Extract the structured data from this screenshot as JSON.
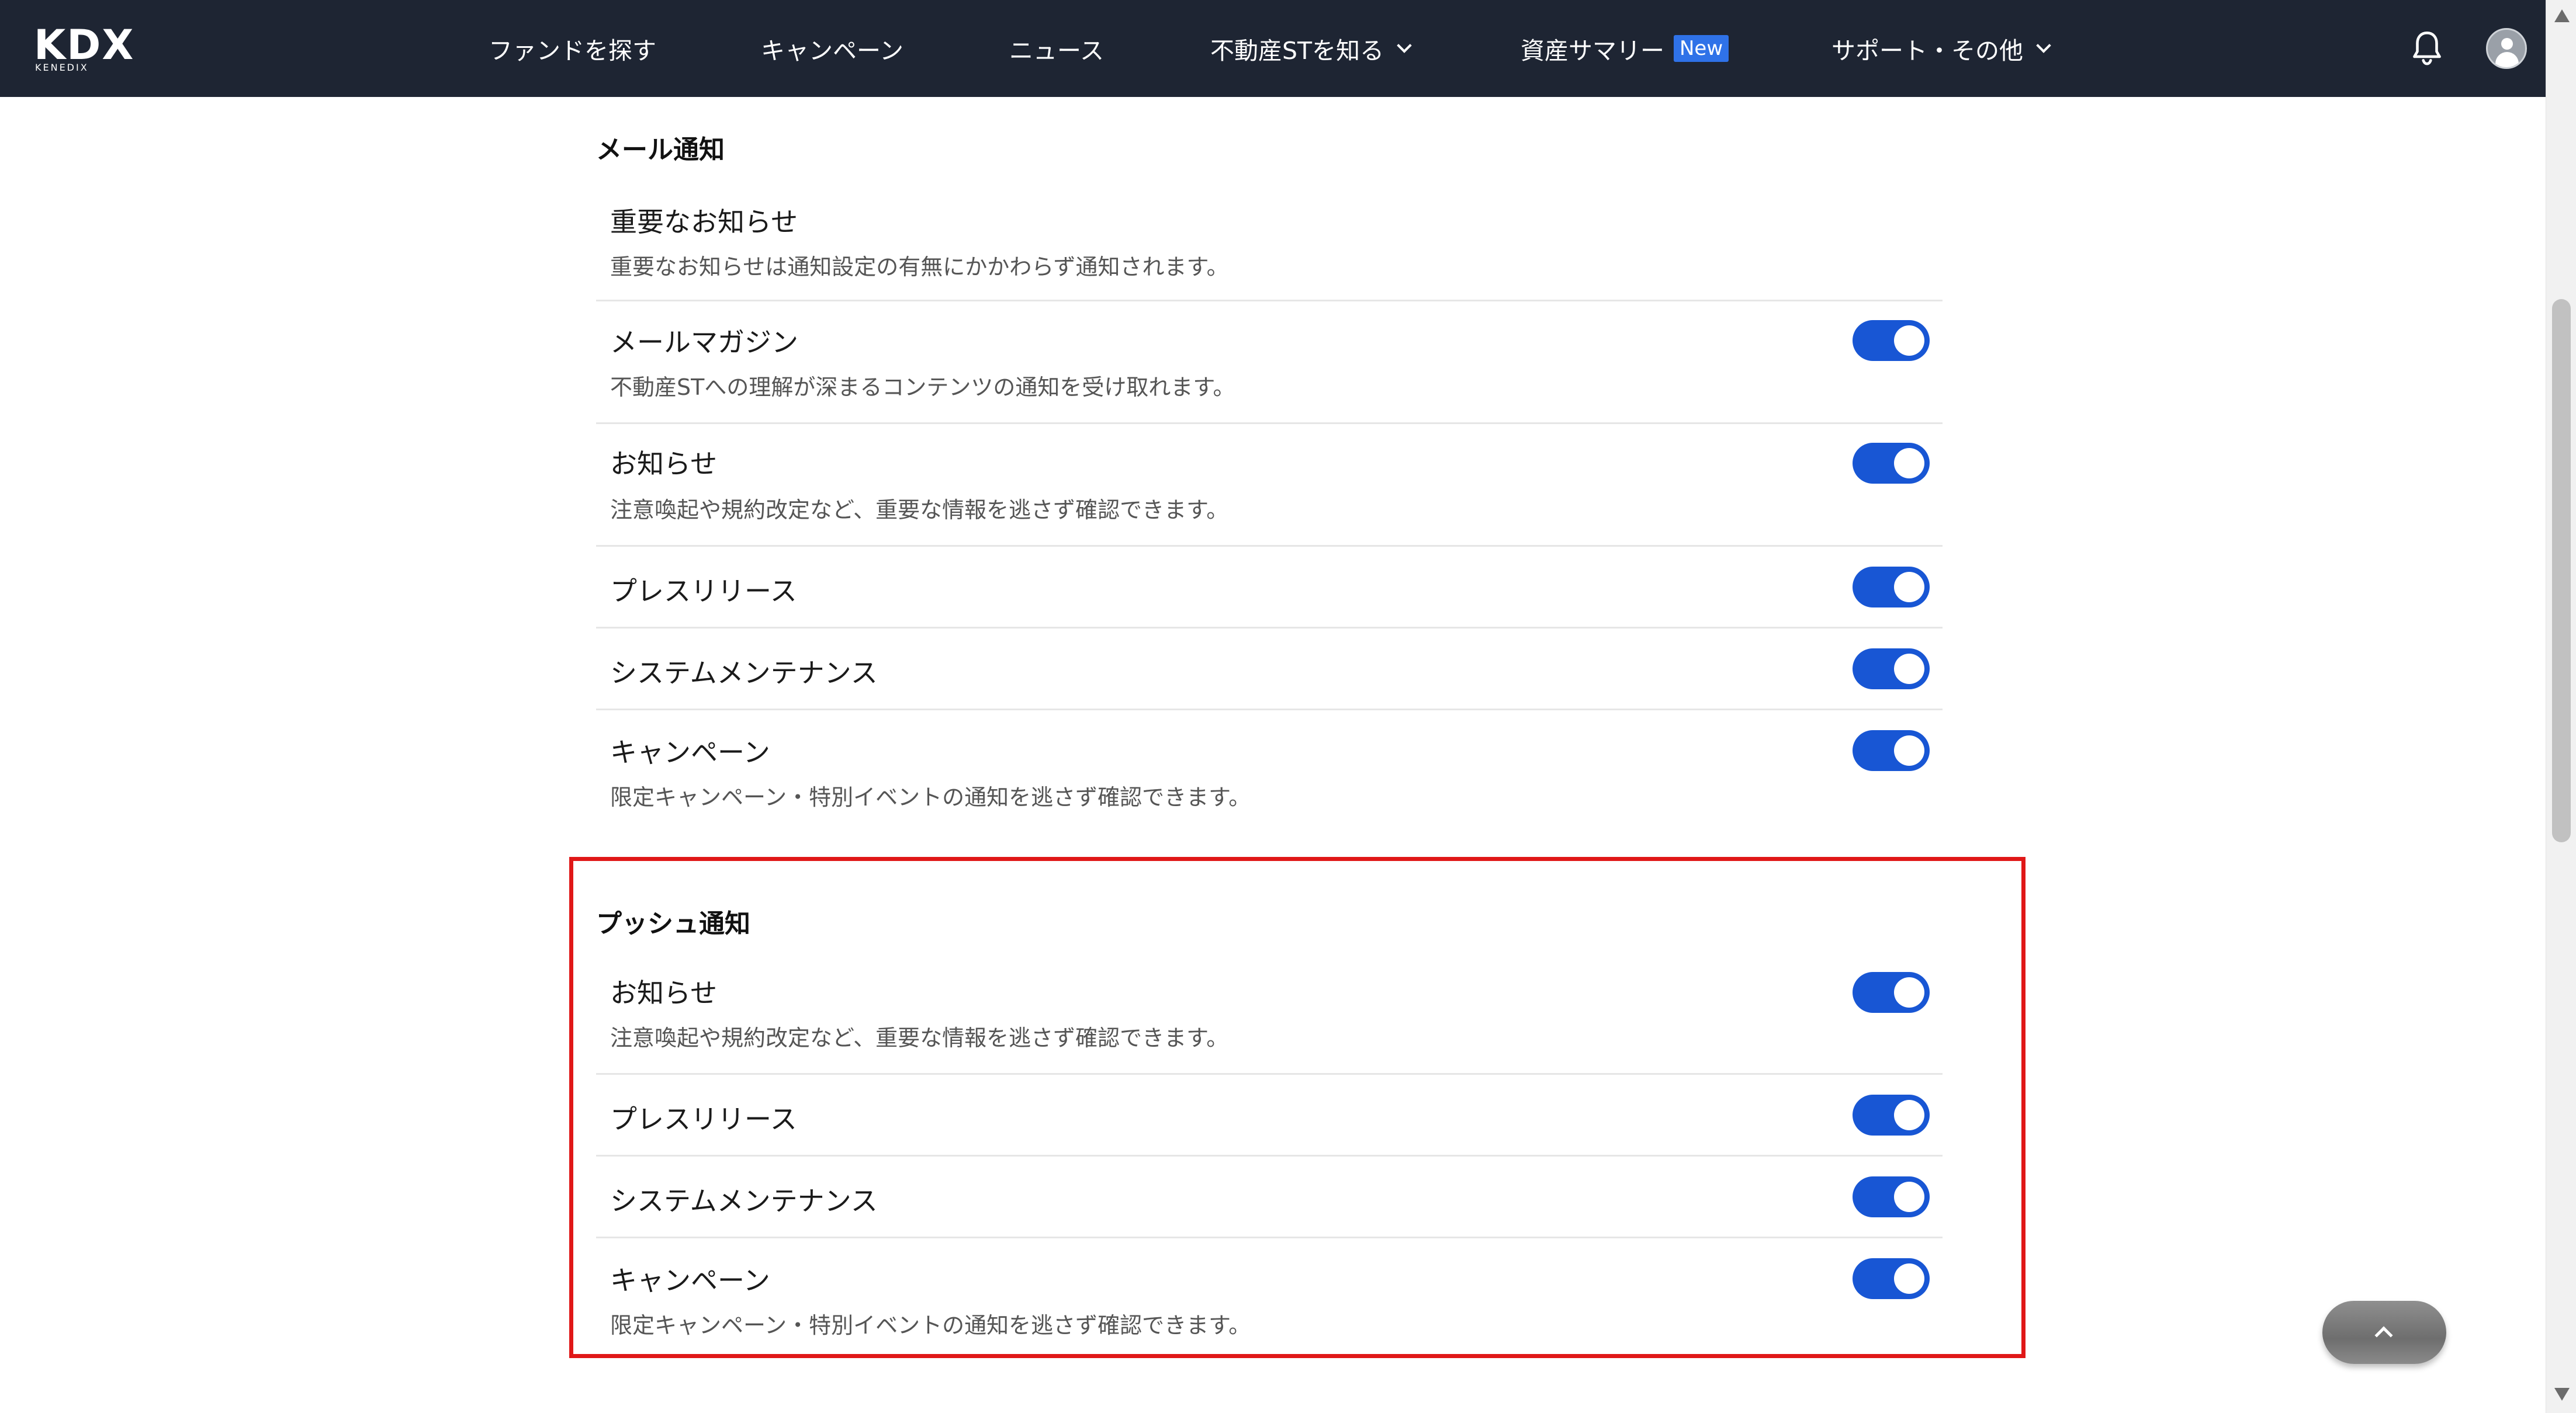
{
  "header": {
    "logo": {
      "main": "KDX",
      "sub": "KENEDIX"
    },
    "nav": [
      {
        "id": "find-funds",
        "label": "ファンドを探す"
      },
      {
        "id": "campaign",
        "label": "キャンペーン"
      },
      {
        "id": "news",
        "label": "ニュース"
      },
      {
        "id": "learn-st",
        "label": "不動産STを知る"
      },
      {
        "id": "asset-summary",
        "label": "資産サマリー",
        "badge": "New"
      },
      {
        "id": "support",
        "label": "サポート・その他"
      }
    ],
    "icons": {
      "notifications": "bell-icon",
      "account": "avatar-icon"
    }
  },
  "mail": {
    "title": "メール通知",
    "items": [
      {
        "title": "重要なお知らせ",
        "desc": "重要なお知らせは通知設定の有無にかかわらず通知されます。",
        "toggle": null
      },
      {
        "title": "メールマガジン",
        "desc": "不動産STへの理解が深まるコンテンツの通知を受け取れます。",
        "toggle": true
      },
      {
        "title": "お知らせ",
        "desc": "注意喚起や規約改定など、重要な情報を逃さず確認できます。",
        "toggle": true
      },
      {
        "title": "プレスリリース",
        "desc": "",
        "toggle": true
      },
      {
        "title": "システムメンテナンス",
        "desc": "",
        "toggle": true
      },
      {
        "title": "キャンペーン",
        "desc": "限定キャンペーン・特別イベントの通知を逃さず確認できます。",
        "toggle": true
      }
    ]
  },
  "push": {
    "title": "プッシュ通知",
    "items": [
      {
        "title": "お知らせ",
        "desc": "注意喚起や規約改定など、重要な情報を逃さず確認できます。",
        "toggle": true
      },
      {
        "title": "プレスリリース",
        "desc": "",
        "toggle": true
      },
      {
        "title": "システムメンテナンス",
        "desc": "",
        "toggle": true
      },
      {
        "title": "キャンペーン",
        "desc": "限定キャンペーン・特別イベントの通知を逃さず確認できます。",
        "toggle": true
      }
    ]
  },
  "colors": {
    "header_bg": "#1e2533",
    "toggle_on": "#1856d4",
    "new_badge": "#2f72e8",
    "highlight": "#e01818"
  }
}
